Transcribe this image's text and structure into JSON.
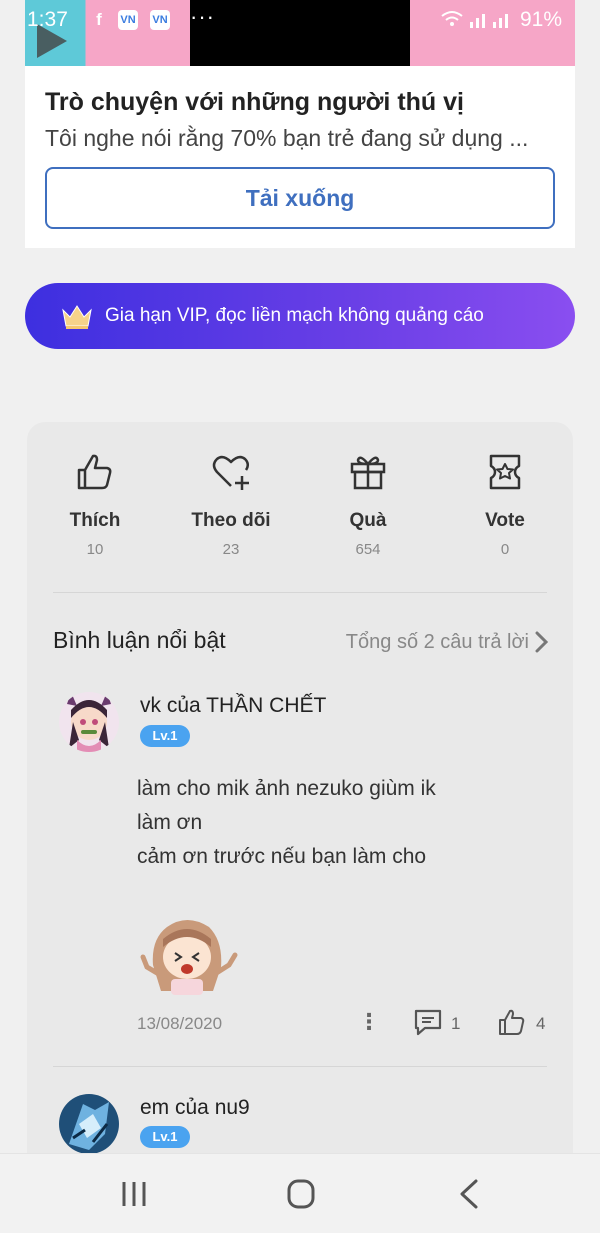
{
  "status_bar": {
    "time": "1:37",
    "battery": "91%",
    "notif_icons": [
      "f",
      "VN",
      "VN"
    ],
    "more": "···"
  },
  "ad": {
    "title": "Trò chuyện với những người thú vị",
    "description": "Tôi nghe nói rằng 70% bạn trẻ đang sử dụng ...",
    "button_label": "Tải xuống"
  },
  "vip": {
    "label": "Gia hạn VIP, đọc liền mạch không quảng cáo"
  },
  "stats": [
    {
      "label": "Thích",
      "count": "10",
      "icon": "thumbs-up-icon"
    },
    {
      "label": "Theo dõi",
      "count": "23",
      "icon": "heart-plus-icon"
    },
    {
      "label": "Quà",
      "count": "654",
      "icon": "gift-icon"
    },
    {
      "label": "Vote",
      "count": "0",
      "icon": "vote-ticket-icon"
    }
  ],
  "comments_section": {
    "title": "Bình luận nổi bật",
    "total": "Tổng số 2 câu trả lời"
  },
  "comments": [
    {
      "name": "vk của THẦN CHẾT",
      "level": "Lv.1",
      "lines": [
        "làm cho mik ảnh nezuko giùm ik",
        "làm ơn",
        "cảm ơn trước nếu bạn làm cho"
      ],
      "date": "13/08/2020",
      "replies": "1",
      "likes": "4"
    },
    {
      "name": "em của nu9",
      "level": "Lv.1"
    }
  ],
  "colors": {
    "accent_blue": "#3f6fbf",
    "vip_start": "#3d2fe0",
    "vip_end": "#8a4ef0",
    "level_badge": "#4aa3f0"
  }
}
